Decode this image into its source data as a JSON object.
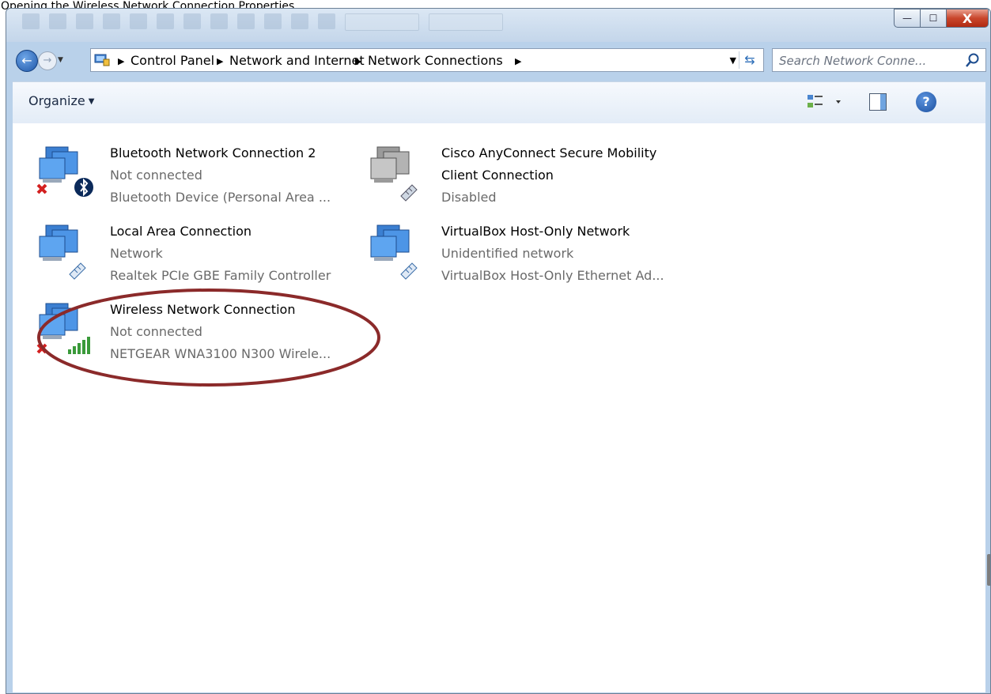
{
  "doc_text": "Opening the Wireless Network Connection Properties",
  "window": {
    "controls": {
      "minimize": "—",
      "maximize": "☐",
      "close": "X"
    }
  },
  "address_bar": {
    "crumbs": [
      "Control Panel",
      "Network and Internet",
      "Network Connections"
    ]
  },
  "search": {
    "placeholder": "Search Network Conne..."
  },
  "toolbar": {
    "organize": "Organize"
  },
  "connections": [
    {
      "name": "Bluetooth Network Connection 2",
      "status": "Not connected",
      "device": "Bluetooth Device (Personal Area ...",
      "icon": "bluetooth-network-icon"
    },
    {
      "name": "Cisco AnyConnect Secure Mobility",
      "name2": "Client Connection",
      "status": "Disabled",
      "icon": "network-adapter-disabled-icon"
    },
    {
      "name": "Local Area Connection",
      "status": "Network",
      "device": "Realtek PCIe GBE Family Controller",
      "icon": "ethernet-network-icon"
    },
    {
      "name": "VirtualBox Host-Only Network",
      "status": "Unidentified network",
      "device": "VirtualBox Host-Only Ethernet Ad...",
      "icon": "ethernet-network-icon"
    },
    {
      "name": "Wireless Network Connection",
      "status": "Not connected",
      "device": "NETGEAR WNA3100 N300 Wirele...",
      "icon": "wireless-network-icon"
    }
  ],
  "colors": {
    "annotation": "#8b2a2a",
    "window_frame": "#b9d1ea",
    "status_text": "#6a6a6a"
  }
}
